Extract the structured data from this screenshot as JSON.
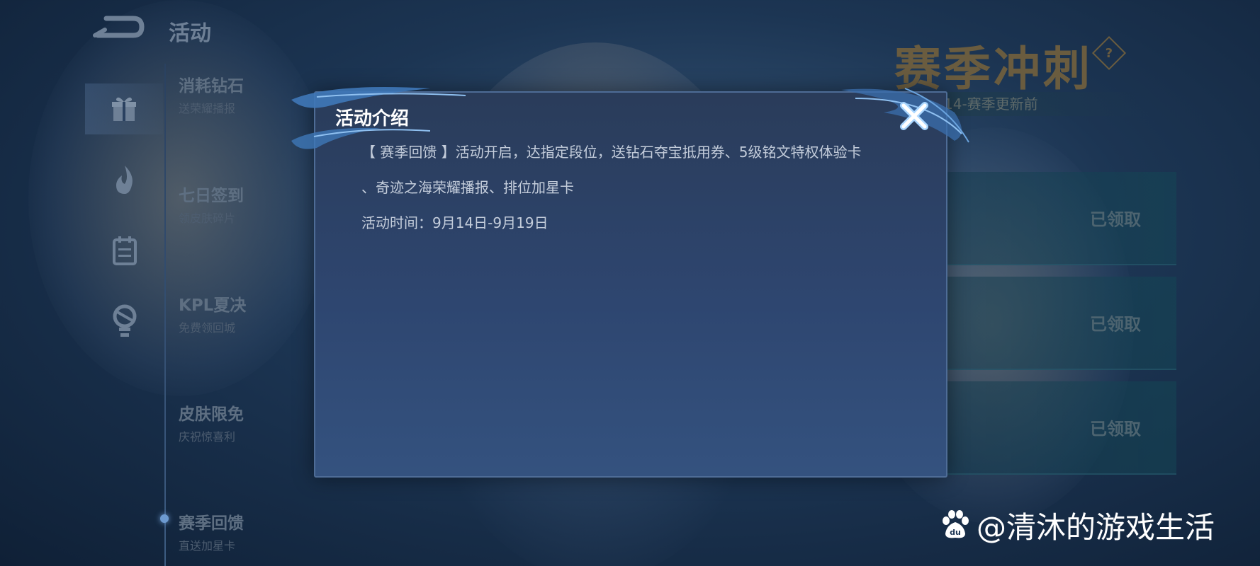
{
  "header": {
    "title": "活动"
  },
  "sidebar": {
    "icons": [
      "gift-icon",
      "flame-icon",
      "calendar-icon",
      "trophy-icon"
    ],
    "items": [
      {
        "title": "消耗钻石",
        "subtitle": "送荣耀播报"
      },
      {
        "title": "七日签到",
        "subtitle": "领皮肤碎片"
      },
      {
        "title": "KPL夏决",
        "subtitle": "免费领回城"
      },
      {
        "title": "皮肤限免",
        "subtitle": "庆祝惊喜利"
      },
      {
        "title": "赛季回馈",
        "subtitle": "直送加星卡"
      }
    ]
  },
  "season_panel": {
    "title": "赛季冲刺",
    "help": "?",
    "subtitle": "14-赛季更新前",
    "rewards": [
      {
        "status": "已领取"
      },
      {
        "status": "已领取"
      },
      {
        "status": "已领取"
      }
    ]
  },
  "modal": {
    "title": "活动介绍",
    "line1": "【 赛季回馈 】活动开启，达指定段位，送钻石夺宝抵用券、5级铭文特权体验卡",
    "line2": "、奇迹之海荣耀播报、排位加星卡",
    "line3": "活动时间：9月14日-9月19日"
  },
  "watermark": {
    "text": "@清沐的游戏生活",
    "paw": "du"
  },
  "colors": {
    "modal_bg": "#2e4670",
    "modal_border": "#4e6c96",
    "title_white": "#ffffff",
    "body_text": "#c4cddb",
    "season_gold": "#6a5c3f"
  }
}
